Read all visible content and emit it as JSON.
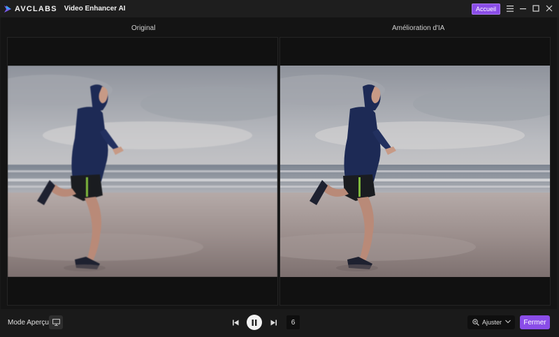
{
  "titlebar": {
    "logo_text": "AVCLABS",
    "app_name": "Video Enhancer AI",
    "home_button": "Accueil"
  },
  "panes": {
    "left_label": "Original",
    "right_label": "Amélioration d'IA"
  },
  "bottombar": {
    "mode_label": "Mode Aperçu",
    "frame_value": "6",
    "zoom_label": "Ajuster",
    "close_button": "Fermer"
  },
  "icons": {
    "menu": "menu-icon",
    "minimize": "minimize-icon",
    "maximize": "maximize-icon",
    "close": "close-icon",
    "preview_mode": "monitor-icon",
    "prev": "skip-previous-icon",
    "pause": "pause-icon",
    "next": "skip-next-icon",
    "zoom": "zoom-in-icon"
  },
  "colors": {
    "accent": "#8a4de8",
    "background": "#1a1a1a"
  }
}
